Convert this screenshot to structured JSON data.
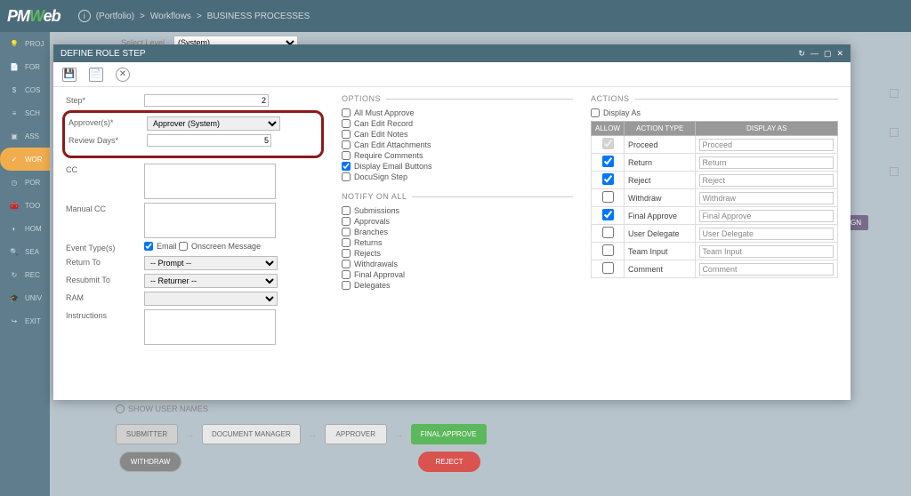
{
  "app": {
    "logo_pm": "PM",
    "logo_w": "W",
    "logo_eb": "eb"
  },
  "breadcrumb": {
    "root": "(Portfolio)",
    "sep": ">",
    "l1": "Workflows",
    "l2": "BUSINESS PROCESSES"
  },
  "level": {
    "label": "Select Level",
    "value": "(System)"
  },
  "sidebar": {
    "items": [
      {
        "icon": "💡",
        "label": "PROJ"
      },
      {
        "icon": "📄",
        "label": "FOR"
      },
      {
        "icon": "$",
        "label": "COS"
      },
      {
        "icon": "≡",
        "label": "SCH"
      },
      {
        "icon": "▣",
        "label": "ASS"
      },
      {
        "icon": "✓",
        "label": "WOR"
      },
      {
        "icon": "◷",
        "label": "POR"
      },
      {
        "icon": "🧰",
        "label": "TOO"
      },
      {
        "icon": "◐",
        "label": "HOM"
      },
      {
        "icon": "🔍",
        "label": "SEA"
      },
      {
        "icon": "↻",
        "label": "REC"
      },
      {
        "icon": "🎓",
        "label": "UNIV"
      },
      {
        "icon": "↪",
        "label": "EXIT"
      }
    ],
    "active_index": 5
  },
  "modal": {
    "title": "DEFINE ROLE STEP",
    "fields": {
      "step_label": "Step*",
      "step_value": "2",
      "approvers_label": "Approver(s)*",
      "approvers_value": "Approver (System)",
      "review_label": "Review Days*",
      "review_value": "5",
      "cc_label": "CC",
      "manual_cc_label": "Manual CC",
      "event_types_label": "Event Type(s)",
      "event_email": "Email",
      "event_onscreen": "Onscreen Message",
      "return_to_label": "Return To",
      "return_to_value": "-- Prompt --",
      "resubmit_to_label": "Resubmit To",
      "resubmit_to_value": "-- Returner --",
      "ram_label": "RAM",
      "instructions_label": "Instructions"
    },
    "options": {
      "title": "OPTIONS",
      "items": [
        {
          "label": "All Must Approve",
          "checked": false
        },
        {
          "label": "Can Edit Record",
          "checked": false
        },
        {
          "label": "Can Edit Notes",
          "checked": false
        },
        {
          "label": "Can Edit Attachments",
          "checked": false
        },
        {
          "label": "Require Comments",
          "checked": false
        },
        {
          "label": "Display Email Buttons",
          "checked": true
        },
        {
          "label": "DocuSign Step",
          "checked": false
        }
      ]
    },
    "notify": {
      "title": "NOTIFY ON ALL",
      "items": [
        {
          "label": "Submissions",
          "checked": false
        },
        {
          "label": "Approvals",
          "checked": false
        },
        {
          "label": "Branches",
          "checked": false
        },
        {
          "label": "Returns",
          "checked": false
        },
        {
          "label": "Rejects",
          "checked": false
        },
        {
          "label": "Withdrawals",
          "checked": false
        },
        {
          "label": "Final Approval",
          "checked": false
        },
        {
          "label": "Delegates",
          "checked": false
        }
      ]
    },
    "actions": {
      "title": "ACTIONS",
      "display_as_label": "Display As",
      "th_allow": "ALLOW",
      "th_action": "ACTION TYPE",
      "th_display": "DISPLAY AS",
      "rows": [
        {
          "allow": true,
          "type": "Proceed",
          "display": "Proceed",
          "disabled": true
        },
        {
          "allow": true,
          "type": "Return",
          "display": "Return"
        },
        {
          "allow": true,
          "type": "Reject",
          "display": "Reject"
        },
        {
          "allow": false,
          "type": "Withdraw",
          "display": "Withdraw"
        },
        {
          "allow": true,
          "type": "Final Approve",
          "display": "Final Approve"
        },
        {
          "allow": false,
          "type": "User Delegate",
          "display": "User Delegate"
        },
        {
          "allow": false,
          "type": "Team Input",
          "display": "Team Input"
        },
        {
          "allow": false,
          "type": "Comment",
          "display": "Comment"
        }
      ]
    }
  },
  "workflow": {
    "show_label": "SHOW USER NAMES",
    "nodes": {
      "submitter": "SUBMITTER",
      "docmgr": "DOCUMENT MANAGER",
      "approver": "APPROVER",
      "final": "FINAL APPROVE",
      "withdraw": "WITHDRAW",
      "reject": "REJECT"
    }
  },
  "bg": {
    "assign": "...SIGN"
  }
}
